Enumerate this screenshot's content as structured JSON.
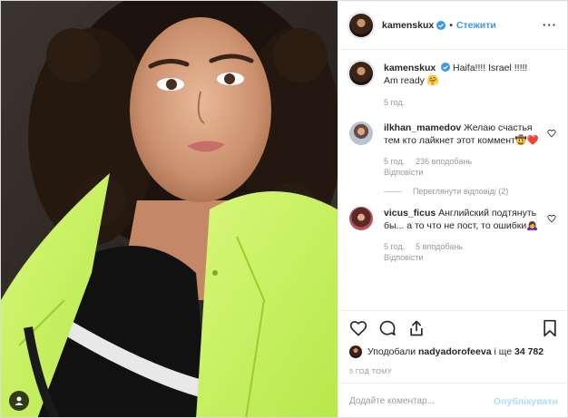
{
  "post": {
    "author": "kamenskux",
    "dot": "•",
    "follow_label": "Стежити",
    "more_icon": "more-horizontal-icon",
    "verified_color": "#3897f0"
  },
  "caption": {
    "author": "kamenskux",
    "text": "Haifa!!!! Israel !!!!! Am ready 🤗",
    "time": "5 год."
  },
  "comments": [
    {
      "author": "ilkhan_mamedov",
      "text": "Желаю счастья тем кто лайкнет этот коммент🤠❤️",
      "time": "5 год.",
      "likes": "236 вподобань",
      "reply": "Відповісти",
      "view_replies": "Переглянути відповіді (2)"
    },
    {
      "author": "vicus_ficus",
      "text": "Английский подтянуть бы... а то что не пост, то ошибки🙇‍♀️",
      "time": "5 год.",
      "likes": "5 вподобань",
      "reply": "Відповісти"
    }
  ],
  "likes": {
    "prefix": "Уподобали",
    "user": "nadyadorofeeva",
    "middle": "і ще",
    "count": "34 782"
  },
  "timeago": "5 ГОД ТОМУ",
  "add_comment": {
    "placeholder": "Додайте коментар...",
    "publish_label": "Опублікувати"
  },
  "colors": {
    "accent": "#3897f0",
    "publish_disabled": "#b3dbff",
    "secondary_text": "#999999",
    "jacket": "#c6f25a"
  }
}
